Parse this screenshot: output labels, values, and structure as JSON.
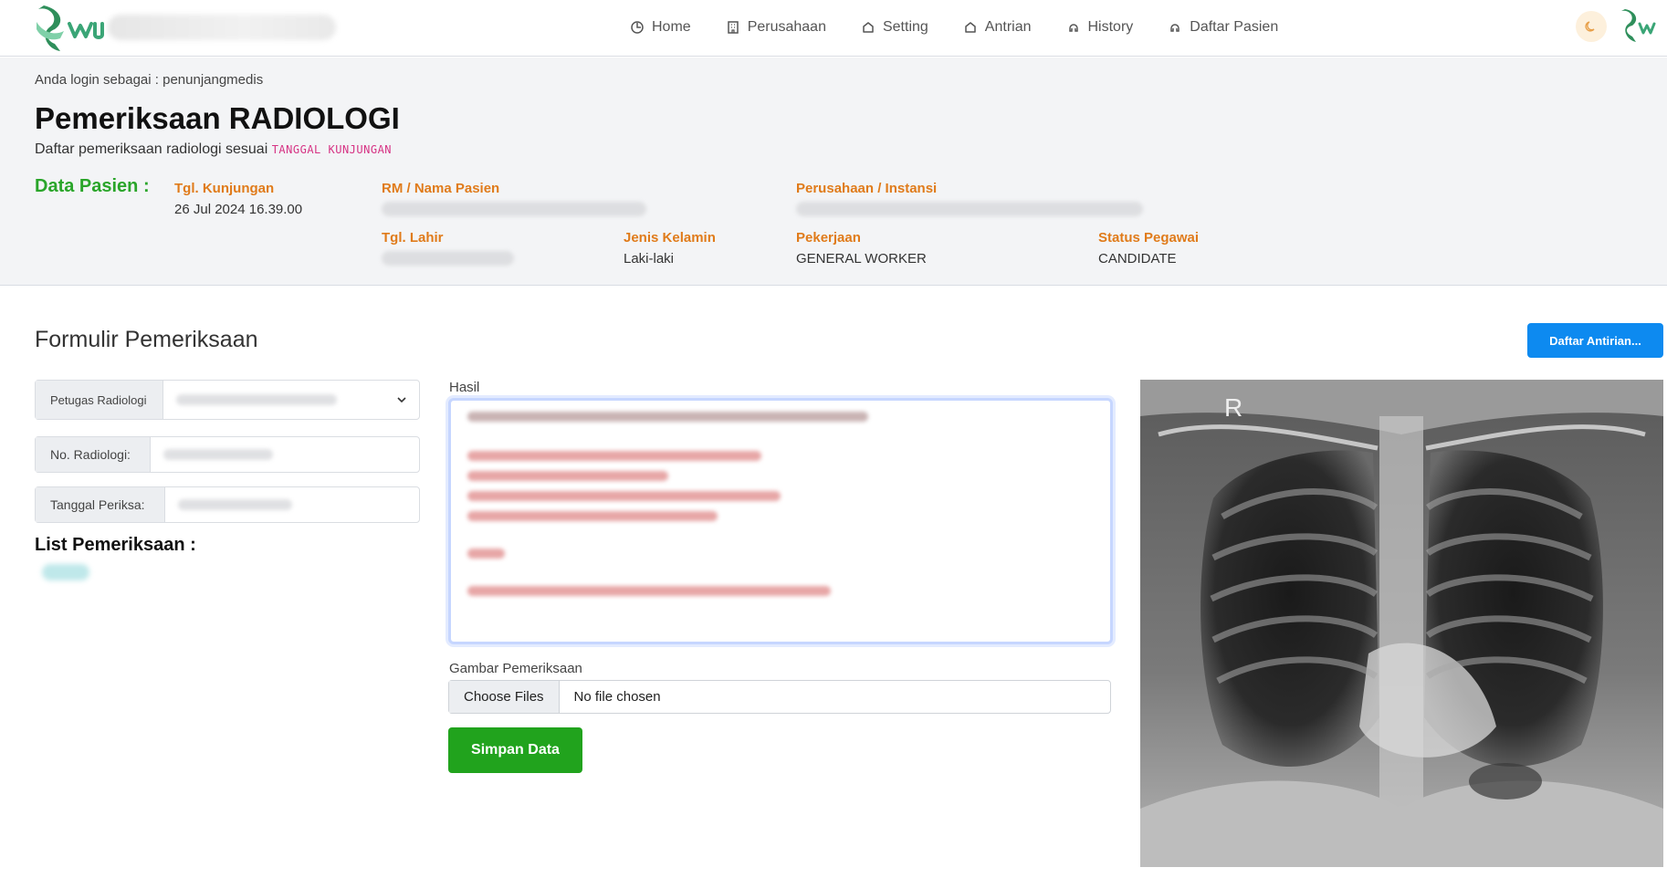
{
  "nav": {
    "items": [
      {
        "label": "Home",
        "icon": "home-icon"
      },
      {
        "label": "Perusahaan",
        "icon": "building-icon"
      },
      {
        "label": "Setting",
        "icon": "setting-icon"
      },
      {
        "label": "Antrian",
        "icon": "queue-icon"
      },
      {
        "label": "History",
        "icon": "history-icon"
      },
      {
        "label": "Daftar Pasien",
        "icon": "patient-list-icon"
      }
    ]
  },
  "header": {
    "login_text": "Anda login sebagai : penunjangmedis",
    "title": "Pemeriksaan RADIOLOGI",
    "subtitle_prefix": "Daftar pemeriksaan radiologi sesuai",
    "subtitle_code": "TANGGAL KUNJUNGAN"
  },
  "patient": {
    "section_label": "Data Pasien :",
    "tgl_kunjungan_label": "Tgl. Kunjungan",
    "tgl_kunjungan_value": "26 Jul 2024 16.39.00",
    "rm_label": "RM / Nama Pasien",
    "perusahaan_label": "Perusahaan / Instansi",
    "tgl_lahir_label": "Tgl. Lahir",
    "jenis_kelamin_label": "Jenis Kelamin",
    "jenis_kelamin_value": "Laki-laki",
    "pekerjaan_label": "Pekerjaan",
    "pekerjaan_value": "GENERAL WORKER",
    "status_label": "Status Pegawai",
    "status_value": "CANDIDATE"
  },
  "form": {
    "title": "Formulir Pemeriksaan",
    "antrian_button": "Daftar Antirian...",
    "petugas_label": "Petugas Radiologi",
    "no_radiologi_label": "No. Radiologi:",
    "tanggal_periksa_label": "Tanggal Periksa:",
    "list_title": "List Pemeriksaan :",
    "hasil_label": "Hasil",
    "gambar_label": "Gambar Pemeriksaan",
    "file_button": "Choose Files",
    "file_status": "No file chosen",
    "save_button": "Simpan Data",
    "xray_marker": "R"
  },
  "colors": {
    "accent_orange": "#e07b1a",
    "accent_green": "#2aa52a",
    "save_green": "#21a31d",
    "primary_blue": "#0d8af0"
  }
}
